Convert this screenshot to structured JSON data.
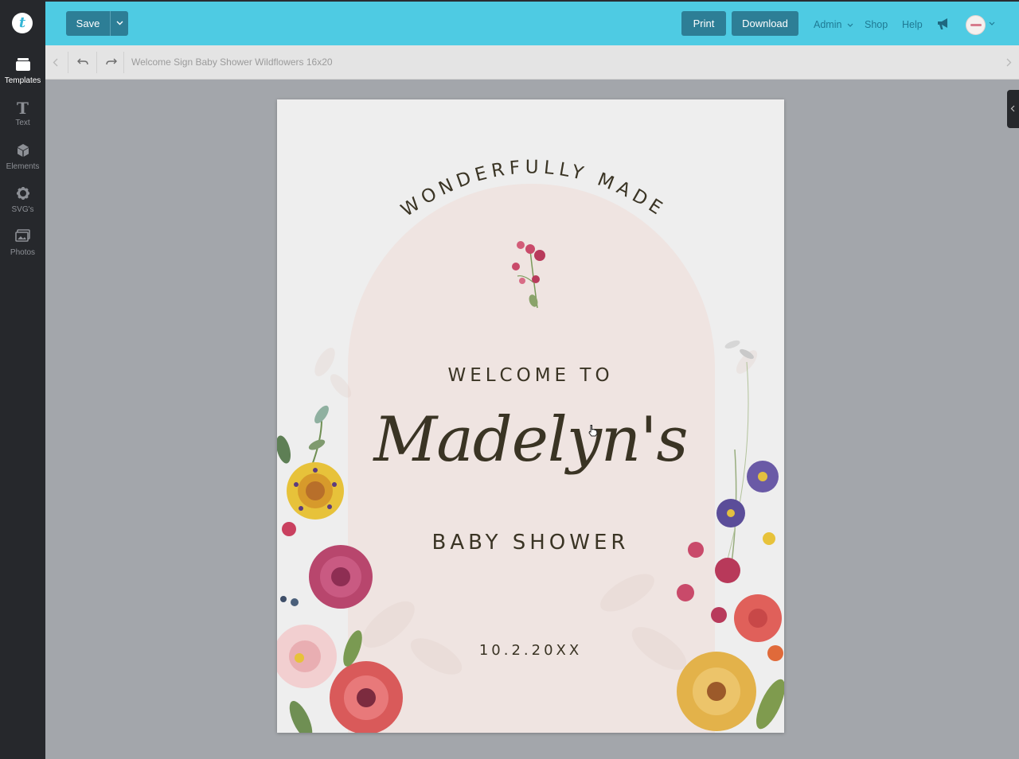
{
  "app": {
    "logo_letter": "t"
  },
  "rail": {
    "items": [
      {
        "label": "Templates",
        "icon": "templates-icon"
      },
      {
        "label": "Text",
        "icon": "text-icon"
      },
      {
        "label": "Elements",
        "icon": "elements-icon"
      },
      {
        "label": "SVG's",
        "icon": "svg-gear-icon"
      },
      {
        "label": "Photos",
        "icon": "photos-icon"
      }
    ],
    "text_glyph": "T"
  },
  "toolbar": {
    "save_label": "Save",
    "print_label": "Print",
    "download_label": "Download",
    "admin_label": "Admin",
    "shop_label": "Shop",
    "help_label": "Help"
  },
  "subbar": {
    "document_title": "Welcome Sign Baby Shower Wildflowers 16x20"
  },
  "sign": {
    "arc_text": "WONDERFULLY MADE",
    "welcome_line": "WELCOME TO",
    "name_line": "Madelyn's",
    "event_line": "BABY SHOWER",
    "date_line": "10.2.20XX"
  },
  "colors": {
    "topbar": "#4ecbe3",
    "button": "#2d7e96",
    "rail": "#26282c",
    "workspace": "#a3a6ab",
    "arch": "#efe4e1",
    "ink": "#3a3424"
  }
}
